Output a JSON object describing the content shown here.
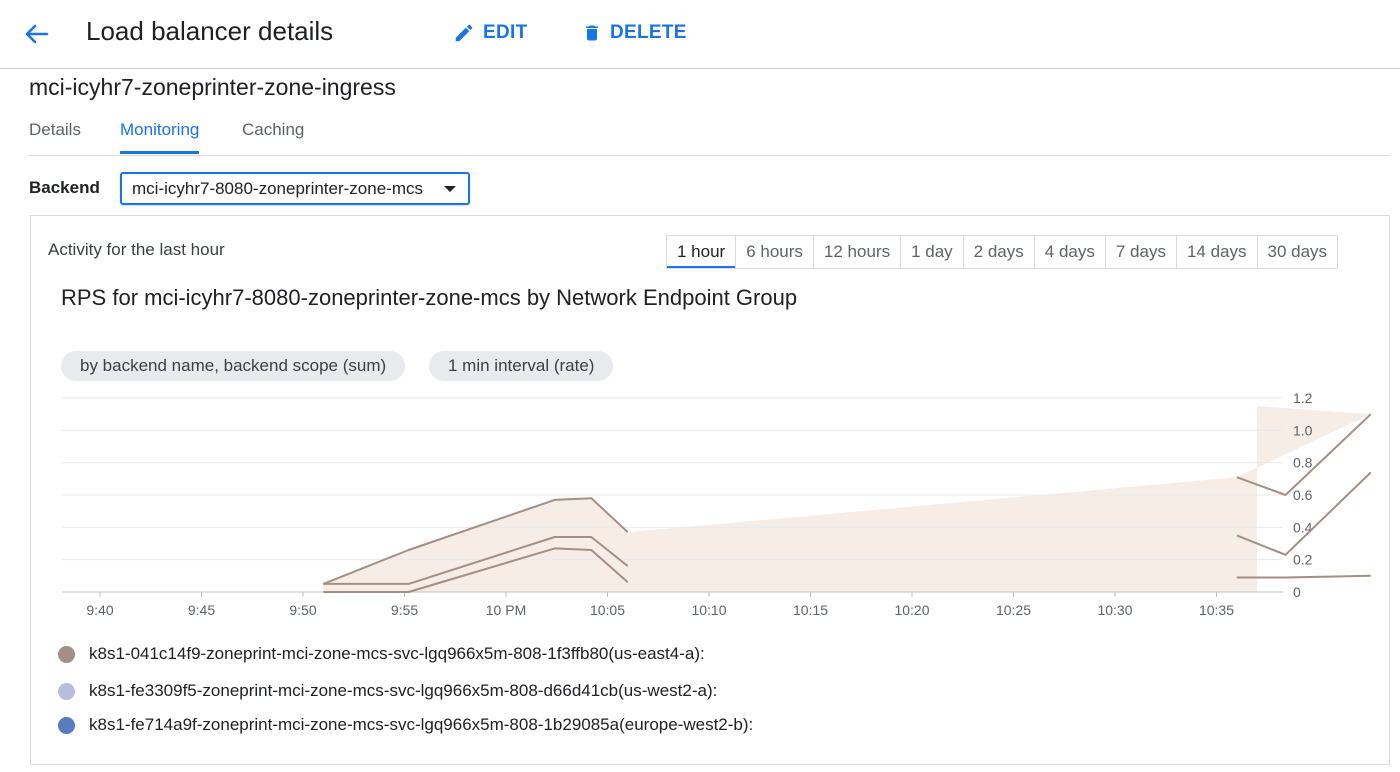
{
  "header": {
    "title": "Load balancer details",
    "edit_label": "EDIT",
    "delete_label": "DELETE"
  },
  "load_balancer_name": "mci-icyhr7-zoneprinter-zone-ingress",
  "tabs": [
    {
      "label": "Details",
      "active": false
    },
    {
      "label": "Monitoring",
      "active": true
    },
    {
      "label": "Caching",
      "active": false
    }
  ],
  "backend": {
    "label": "Backend",
    "selected": "mci-icyhr7-8080-zoneprinter-zone-mcs"
  },
  "activity": {
    "label": "Activity for the last hour",
    "ranges": [
      "1 hour",
      "6 hours",
      "12 hours",
      "1 day",
      "2 days",
      "4 days",
      "7 days",
      "14 days",
      "30 days"
    ],
    "selected_range": "1 hour"
  },
  "chart_data": {
    "type": "line",
    "title": "RPS for mci-icyhr7-8080-zoneprinter-zone-mcs by Network Endpoint Group",
    "filters": [
      "by backend name, backend scope (sum)",
      "1 min interval (rate)"
    ],
    "x_ticks": [
      "9:40",
      "9:45",
      "9:50",
      "9:55",
      "10 PM",
      "10:05",
      "10:10",
      "10:15",
      "10:20",
      "10:25",
      "10:30",
      "10:35"
    ],
    "y_ticks": [
      "0",
      "0.2",
      "0.4",
      "0.6",
      "0.8",
      "1.0",
      "1.2"
    ],
    "ylim": [
      0,
      1.2
    ],
    "grid": true,
    "colors": {
      "series1": "#a38f84",
      "series2": "#b7bedd",
      "series3": "#5b7bc0",
      "area": "#f6ede6"
    },
    "series": [
      {
        "name": "k8s1-041c14f9-zoneprint-mci-zone-mcs-svc-lgq966x5m-808-1f3ffb80(us-east4-a):",
        "color": "#a38f84",
        "segments": [
          [
            [
              9.85,
              0.05
            ],
            [
              9.92,
              0.26
            ],
            [
              10.04,
              0.57
            ],
            [
              10.07,
              0.58
            ],
            [
              10.1,
              0.37
            ]
          ],
          [
            [
              10.6,
              0.71
            ],
            [
              10.64,
              0.6
            ],
            [
              10.71,
              1.1
            ]
          ]
        ]
      },
      {
        "name": "k8s1-fe3309f5-zoneprint-mci-zone-mcs-svc-lgq966x5m-808-d66d41cb(us-west2-a):",
        "color": "#b7bedd",
        "segments": [
          [
            [
              9.85,
              0.05
            ],
            [
              9.92,
              0.05
            ],
            [
              10.04,
              0.34
            ],
            [
              10.07,
              0.34
            ],
            [
              10.1,
              0.16
            ]
          ],
          [
            [
              10.6,
              0.35
            ],
            [
              10.64,
              0.23
            ],
            [
              10.71,
              0.74
            ]
          ]
        ]
      },
      {
        "name": "k8s1-fe714a9f-zoneprint-mci-zone-mcs-svc-lgq966x5m-808-1b29085a(europe-west2-b):",
        "color": "#5b7bc0",
        "segments": [
          [
            [
              9.85,
              0.0
            ],
            [
              9.92,
              0.0
            ],
            [
              10.04,
              0.27
            ],
            [
              10.07,
              0.26
            ],
            [
              10.1,
              0.06
            ]
          ],
          [
            [
              10.6,
              0.09
            ],
            [
              10.64,
              0.09
            ],
            [
              10.71,
              0.1
            ]
          ]
        ]
      }
    ],
    "area": [
      [
        9.85,
        0.05
      ],
      [
        9.92,
        0.26
      ],
      [
        10.04,
        0.57
      ],
      [
        10.07,
        0.58
      ],
      [
        10.1,
        0.37
      ],
      [
        10.6,
        0.71
      ],
      [
        10.71,
        1.1
      ]
    ]
  }
}
